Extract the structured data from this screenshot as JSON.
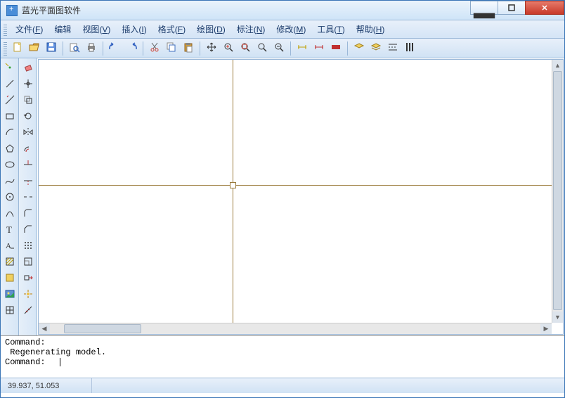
{
  "title": "蓝光平面图软件",
  "menu": [
    {
      "label": "文件",
      "key": "F"
    },
    {
      "label": "编辑",
      "key": ""
    },
    {
      "label": "视图",
      "key": "V"
    },
    {
      "label": "插入",
      "key": "I"
    },
    {
      "label": "格式",
      "key": "F"
    },
    {
      "label": "绘图",
      "key": "D"
    },
    {
      "label": "标注",
      "key": "N"
    },
    {
      "label": "修改",
      "key": "M"
    },
    {
      "label": "工具",
      "key": "T"
    },
    {
      "label": "帮助",
      "key": "H"
    }
  ],
  "toolbar_main": [
    "new",
    "open",
    "save",
    "|",
    "preview",
    "print",
    "|",
    "undo",
    "redo",
    "|",
    "cut",
    "copy",
    "paste",
    "|",
    "pan",
    "zoom-in",
    "zoom-extents",
    "zoom-window",
    "zoom-realtime",
    "|",
    "dim1",
    "dim2",
    "dim3",
    "|",
    "layer1",
    "layer2",
    "layer3",
    "layer4"
  ],
  "toolbar_left1": [
    "point",
    "line",
    "xline",
    "rect",
    "arc-tool",
    "polygon",
    "ellipse",
    "spline",
    "circle-t",
    "curve",
    "text",
    "mtext",
    "hatch",
    "fill",
    "image",
    "grid"
  ],
  "toolbar_left2": [
    "erase",
    "move",
    "copy2",
    "rotate",
    "mirror",
    "offset",
    "trim",
    "extend",
    "break",
    "fillet",
    "chamfer",
    "array",
    "scale",
    "stretch",
    "explode",
    "measure"
  ],
  "command_lines": [
    "Command:",
    " Regenerating model.",
    "Command:  "
  ],
  "status_coords": "39.937,   51.053"
}
